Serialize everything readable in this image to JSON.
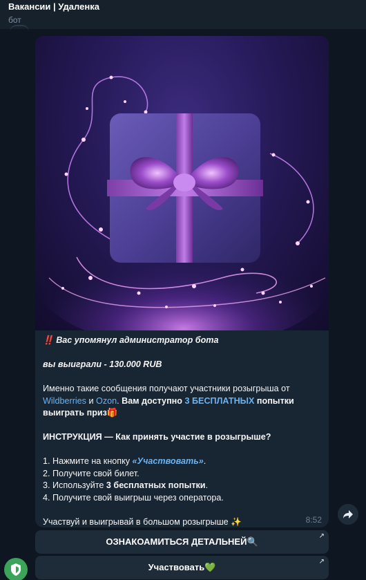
{
  "header": {
    "title": "Вакансии | Удаленка",
    "subtitle": "бот"
  },
  "message": {
    "alert_emoji": "‼️",
    "mention_line": "Вас упомянул администратор бота",
    "win_line": "вы выиграли - 130.000 RUB",
    "para1_a": "Именно такие сообщения получают участники розыгрыша от ",
    "para1_wb": "Wildberries",
    "para1_and": " и ",
    "para1_ozon": "Ozon",
    "para1_dot": ". ",
    "para1_b1": "Вам доступно ",
    "para1_free": "3 БЕСПЛАТНЫХ",
    "para1_b2": " попытки выиграть приз",
    "gift_emoji": "🎁",
    "instruction_title": "ИНСТРУКЦИЯ — Как принять участие в розыгрыше?",
    "step1_a": "1. Нажмите на кнопку ",
    "step1_link": "«Участвовать»",
    "step1_b": ".",
    "step2": "2. Получите свой билет.",
    "step3_a": "3. Используйте ",
    "step3_b": "3 бесплатных попытки",
    "step3_c": ".",
    "step4": "4. Получите свой выигрыш через оператора.",
    "closing": "Участвуй и выигрывай в большом розыгрыше ",
    "sparkle_emoji": "✨",
    "time": "8:52"
  },
  "buttons": {
    "details": "ОЗНАКОАМИТЬСЯ ДЕТАЛЬНЕЙ🔍",
    "participate": "Участвовать💚",
    "corner_arrow": "↗"
  },
  "colors": {
    "background": "#0e1621",
    "bubble": "#182533",
    "link": "#6ab3f3",
    "button": "#1e2c3a"
  }
}
